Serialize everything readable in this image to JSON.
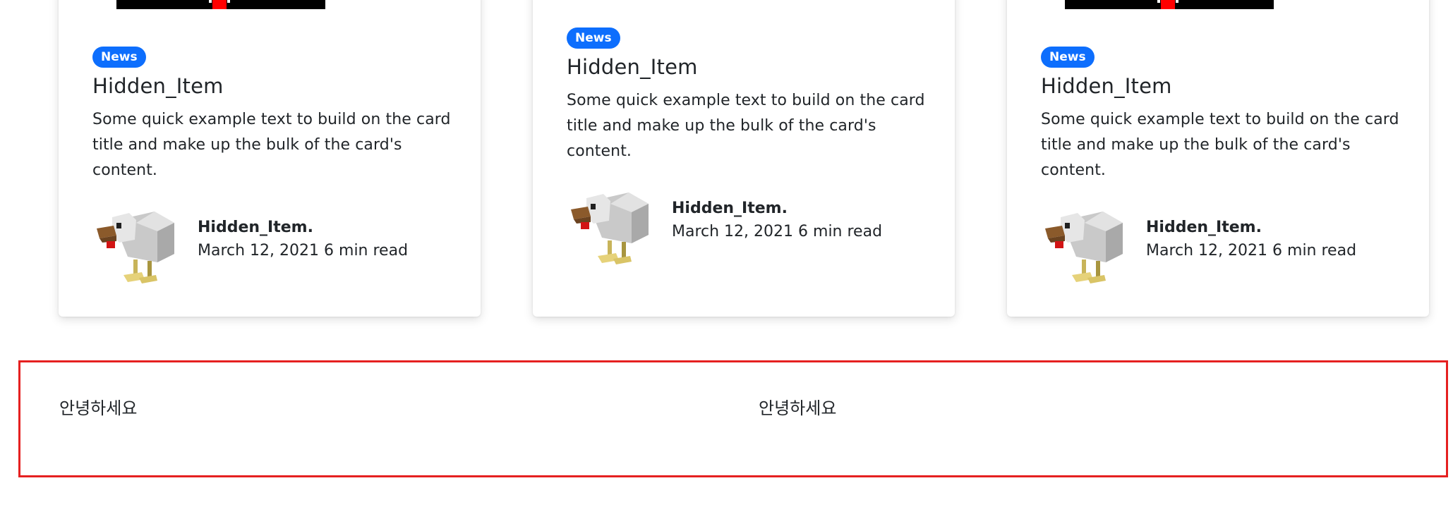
{
  "cards": [
    {
      "badge": "News",
      "title": "Hidden_Item",
      "text": "Some quick example text to build on the card title and make up the bulk of the card's content.",
      "author_name": "Hidden_Item.",
      "meta": "March 12, 2021 6 min read",
      "avatar_icon": "chicken-avatar-icon"
    },
    {
      "badge": "News",
      "title": "Hidden_Item",
      "text": "Some quick example text to build on the card title and make up the bulk of the card's content.",
      "author_name": "Hidden_Item.",
      "meta": "March 12, 2021 6 min read",
      "avatar_icon": "chicken-avatar-icon"
    },
    {
      "badge": "News",
      "title": "Hidden_Item",
      "text": "Some quick example text to build on the card title and make up the bulk of the card's content.",
      "author_name": "Hidden_Item.",
      "meta": "March 12, 2021 6 min read",
      "avatar_icon": "chicken-avatar-icon"
    }
  ],
  "footer": {
    "text_left": "안녕하세요",
    "text_right": "안녕하세요",
    "border_color": "#e52020"
  },
  "colors": {
    "badge": "#0d6efd",
    "card_image": "#000000",
    "card_image_accent": "#ff0000"
  }
}
